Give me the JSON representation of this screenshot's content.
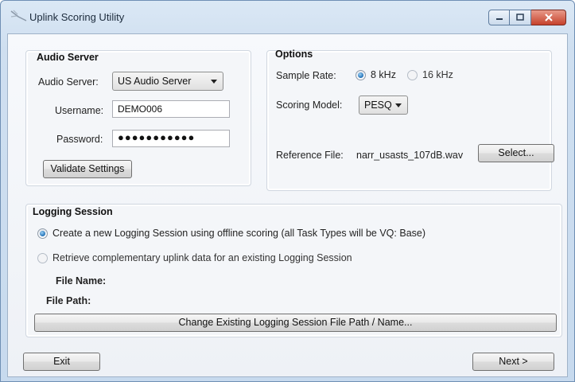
{
  "window": {
    "title": "Uplink Scoring Utility",
    "accent_color": "#cfdff0",
    "close_color": "#c6422c"
  },
  "audio_server": {
    "group_title": "Audio Server",
    "server_label": "Audio Server:",
    "server_value": "US Audio Server",
    "username_label": "Username:",
    "username_value": "DEMO006",
    "password_label": "Password:",
    "password_value": "●●●●●●●●●●●",
    "validate_label": "Validate Settings"
  },
  "options": {
    "group_title": "Options",
    "sample_rate_label": "Sample Rate:",
    "rate_8k": "8 kHz",
    "rate_16k": "16 kHz",
    "selected_rate": "8 kHz",
    "scoring_model_label": "Scoring Model:",
    "scoring_model_value": "PESQ",
    "reference_file_label": "Reference File:",
    "reference_file_value": "narr_usasts_107dB.wav",
    "select_label": "Select..."
  },
  "logging_session": {
    "group_title": "Logging Session",
    "option_create": "Create a new Logging Session using offline scoring (all Task Types will be VQ: Base)",
    "option_retrieve": "Retrieve complementary uplink data for an existing Logging Session",
    "selected_option": "create",
    "file_name_label": "File Name:",
    "file_path_label": "File Path:",
    "change_path_label": "Change Existing Logging Session File Path / Name..."
  },
  "footer": {
    "exit_label": "Exit",
    "next_label": "Next >"
  }
}
